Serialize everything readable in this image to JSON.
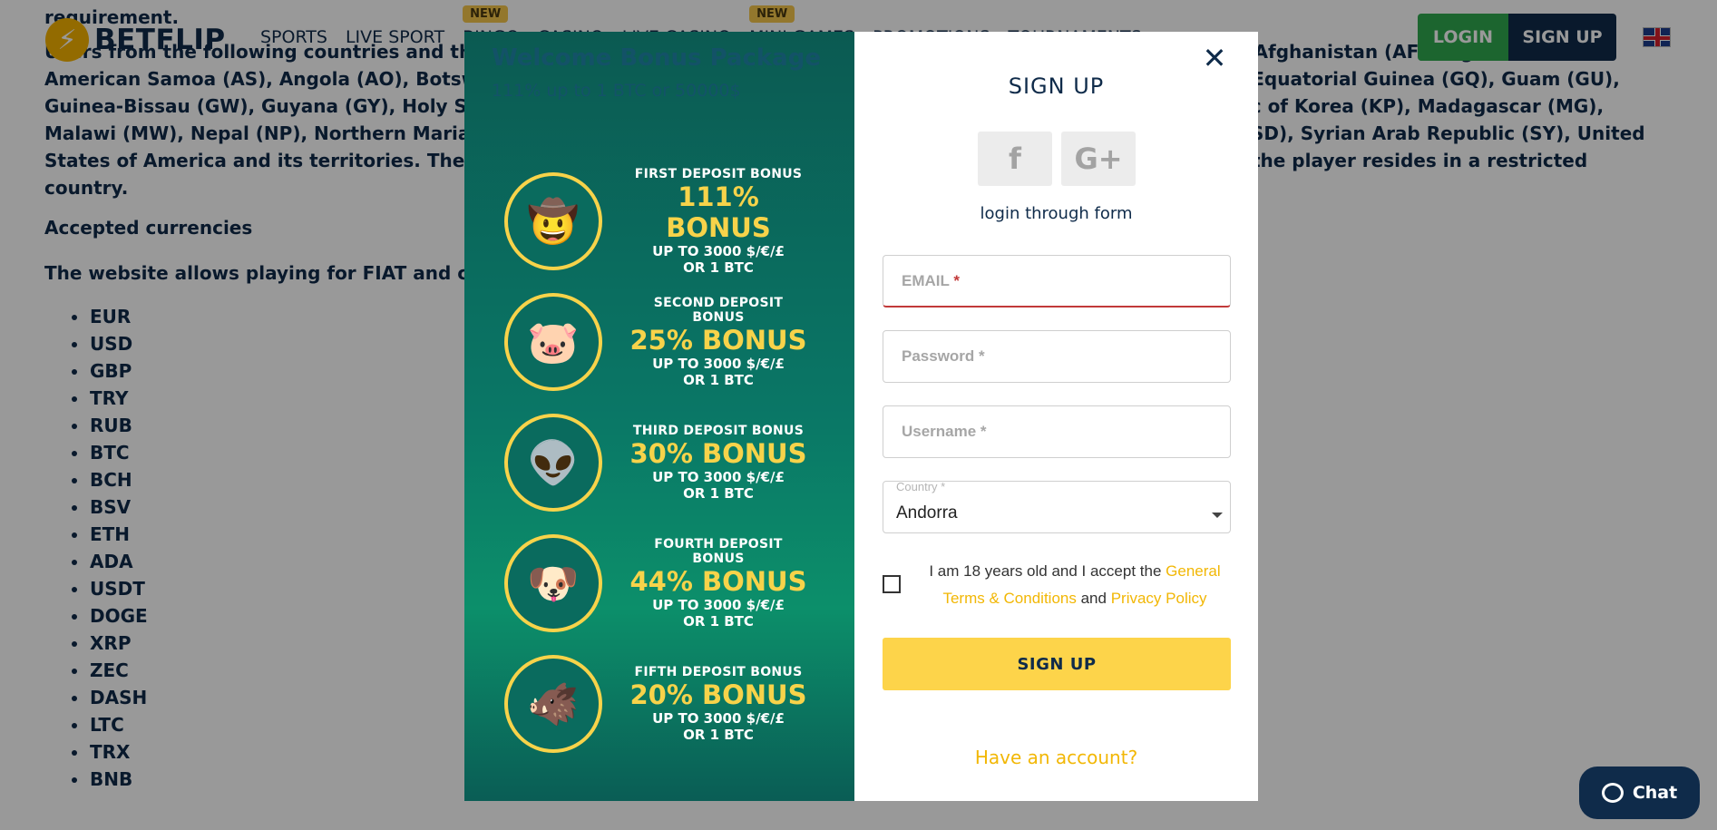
{
  "header": {
    "logo_text": "BETFLIP",
    "logo_glyph": "⚡",
    "nav": [
      {
        "label": "SPORTS",
        "badge": ""
      },
      {
        "label": "LIVE SPORT",
        "badge": ""
      },
      {
        "label": "BINGO",
        "badge": "NEW"
      },
      {
        "label": "CASINO",
        "badge": ""
      },
      {
        "label": "LIVE CASINO",
        "badge": ""
      },
      {
        "label": "MINI GAMES",
        "badge": "NEW"
      },
      {
        "label": "PROMOTIONS",
        "badge": ""
      },
      {
        "label": "TOURNAMENTS",
        "badge": ""
      }
    ],
    "login_label": "LOGIN",
    "signup_label": "SIGN UP",
    "language_icon": "uk-flag-icon"
  },
  "content": {
    "requirement": "requirement.",
    "countries_text": "Users from the following countries and their territories are not allowed to play for real money on the website games: Afghanistan (AF), Algeria (DZ), American Samoa (AS), Angola (AO), Botswana (BW), Burma (MM), Cuba (CU), Democratic Republic of the Congo (CD), Equatorial Guinea (GQ), Guam (GU), Guinea-Bissau (GW), Guyana (GY), Holy See (Vatican City State) (VA), Iran (IR), Iraq (IQ), Democratic People's Republic of Korea (KP), Madagascar (MG), Malawi (MW), Nepal (NP), Northern Mariana Islands (MO), Sierra Leone (SL), Somalia (SO), South Sudan (SS), Sudan (SD), Syrian Arab Republic (SY), United States of America and its territories. The casino cannot guarantee successful processing of withdrawals or refunds if the player resides in a restricted country.",
    "accepted_currencies": "Accepted currencies",
    "fiat_text": "The website allows playing for FIAT and cryptocurrencies:",
    "currencies": [
      "EUR",
      "USD",
      "GBP",
      "TRY",
      "RUB",
      "BTC",
      "BCH",
      "BSV",
      "ETH",
      "ADA",
      "USDT",
      "DOGE",
      "XRP",
      "ZEC",
      "DASH",
      "LTC",
      "TRX",
      "BNB"
    ]
  },
  "modal": {
    "promo": {
      "title": "Welcome Bonus Package",
      "subtitle": "111% up to 1 BTC or 50000$",
      "bonuses": [
        {
          "label": "FIRST DEPOSIT BONUS",
          "pct": "111% BONUS",
          "limit1": "UP TO 3000 $/€/£",
          "limit2": "OR 1 BTC",
          "mascot": "🤠"
        },
        {
          "label": "SECOND DEPOSIT BONUS",
          "pct": "25% BONUS",
          "limit1": "UP TO 3000 $/€/£",
          "limit2": "OR 1 BTC",
          "mascot": "🐷"
        },
        {
          "label": "THIRD DEPOSIT BONUS",
          "pct": "30% BONUS",
          "limit1": "UP TO 3000 $/€/£",
          "limit2": "OR 1 BTC",
          "mascot": "👽"
        },
        {
          "label": "FOURTH DEPOSIT BONUS",
          "pct": "44% BONUS",
          "limit1": "UP TO 3000 $/€/£",
          "limit2": "OR 1 BTC",
          "mascot": "🐶"
        },
        {
          "label": "FIFTH DEPOSIT BONUS",
          "pct": "20% BONUS",
          "limit1": "UP TO 3000 $/€/£",
          "limit2": "OR 1 BTC",
          "mascot": "🐗"
        }
      ]
    },
    "form": {
      "close_glyph": "✕",
      "title": "SIGN UP",
      "social": [
        {
          "icon": "facebook-icon",
          "glyph": "f"
        },
        {
          "icon": "google-plus-icon",
          "glyph": "G+"
        }
      ],
      "login_through_form": "login through form",
      "email_label": "EMAIL",
      "email_required": "*",
      "password_placeholder": "Password *",
      "username_placeholder": "Username *",
      "country_label": "Country *",
      "country_value": "Andorra",
      "terms_prefix": "I am 18 years old and I accept the",
      "terms_link": "General Terms & Conditions",
      "terms_and": "and",
      "privacy_link": "Privacy Policy",
      "submit_label": "SIGN UP",
      "have_account": "Have an account?"
    }
  },
  "chat": {
    "label": "Chat"
  },
  "colors": {
    "navy": "#0f2b4a",
    "yellow": "#fdd44a",
    "green": "#2fa84f",
    "promo_teal": "#0a7766"
  }
}
